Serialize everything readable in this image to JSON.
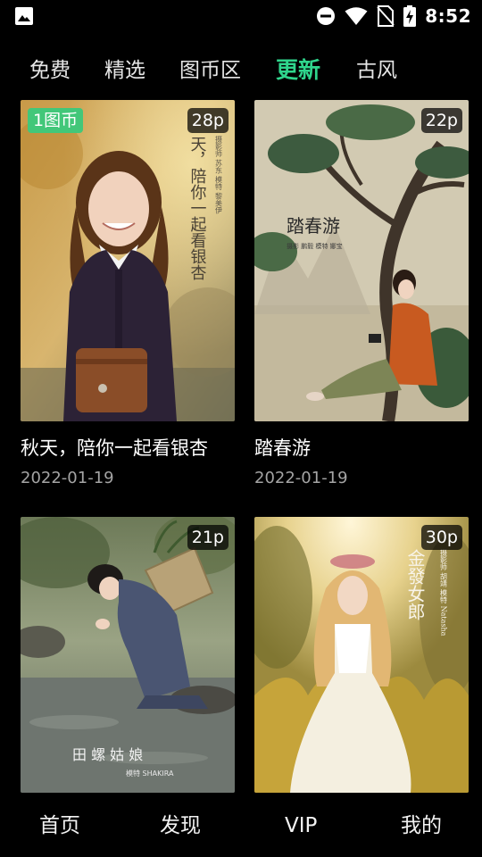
{
  "status_bar": {
    "time": "8:52",
    "icons": [
      "image-notification-icon",
      "do-not-disturb-icon",
      "wifi-icon",
      "no-sim-icon",
      "battery-charging-icon"
    ]
  },
  "tabs": [
    {
      "label": "免费",
      "active": false
    },
    {
      "label": "精选",
      "active": false
    },
    {
      "label": "图币区",
      "active": false
    },
    {
      "label": "更新",
      "active": true
    },
    {
      "label": "古风",
      "active": false
    }
  ],
  "cards": [
    {
      "title": "秋天，陪你一起看银杏",
      "date": "2022-01-19",
      "count": "28p",
      "price": "1图币",
      "poster_text": "天，陪你一起看银杏",
      "poster_credits": "摄影师 苏东  模特 黎美伊"
    },
    {
      "title": "踏春游",
      "date": "2022-01-19",
      "count": "22p",
      "poster_text": "踏春游",
      "poster_credits": "摄影 鹏毅   模特 娜宝"
    },
    {
      "title": "",
      "date": "",
      "count": "21p",
      "poster_text": "田 螺 姑 娘",
      "poster_credits": "模特 SHAKIRA"
    },
    {
      "title": "",
      "date": "",
      "count": "30p",
      "poster_text": "金發女郎",
      "poster_credits": "摄影师 胡靖  模特 Natasha"
    }
  ],
  "bottom_nav": [
    {
      "label": "首页"
    },
    {
      "label": "发现"
    },
    {
      "label": "VIP"
    },
    {
      "label": "我的"
    }
  ],
  "colors": {
    "accent": "#2fd58c",
    "price_badge": "#42c779",
    "background": "#000000",
    "date_text": "#a4a4a4"
  }
}
